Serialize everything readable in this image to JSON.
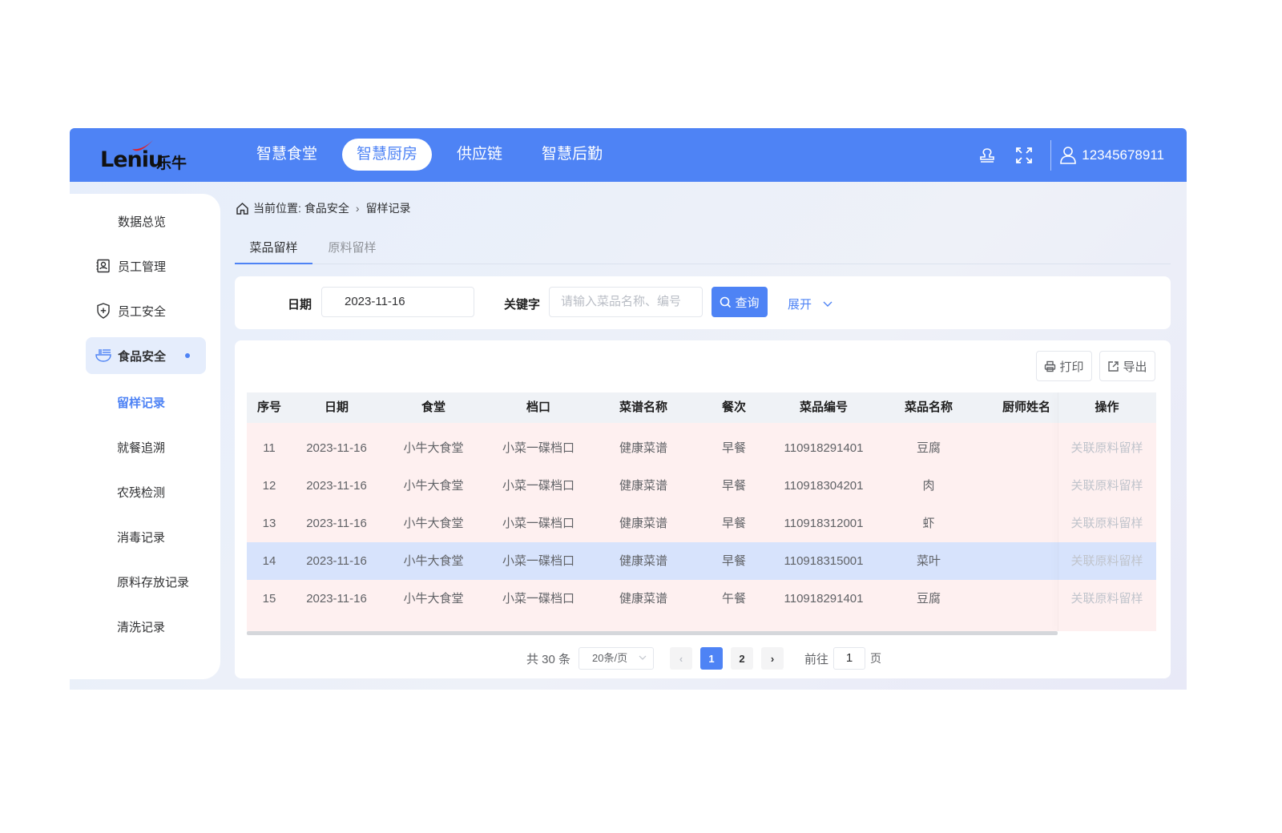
{
  "header": {
    "logo_word": "Leniu",
    "logo_cn": "乐牛",
    "nav": [
      {
        "label": "智慧食堂",
        "active": false
      },
      {
        "label": "智慧厨房",
        "active": true
      },
      {
        "label": "供应链",
        "active": false
      },
      {
        "label": "智慧后勤",
        "active": false
      }
    ],
    "icons": [
      "stamp-icon",
      "fullscreen-icon"
    ],
    "username": "12345678911",
    "brand_color": "#4e83f5"
  },
  "sidebar": {
    "items": [
      {
        "label": "数据总览",
        "icon": ""
      },
      {
        "label": "员工管理",
        "icon": "badge-icon"
      },
      {
        "label": "员工安全",
        "icon": "shield-plus-icon"
      },
      {
        "label": "食品安全",
        "icon": "bowl-icon",
        "active": true
      }
    ],
    "sub_items": [
      {
        "label": "留样记录",
        "active": true
      },
      {
        "label": "就餐追溯"
      },
      {
        "label": "农残检测"
      },
      {
        "label": "消毒记录"
      },
      {
        "label": "原料存放记录"
      },
      {
        "label": "清洗记录"
      }
    ]
  },
  "breadcrumb": {
    "prefix": "当前位置:",
    "level1": "食品安全",
    "level2": "留样记录"
  },
  "tabs": [
    {
      "label": "菜品留样",
      "active": true
    },
    {
      "label": "原料留样",
      "active": false
    }
  ],
  "search": {
    "date_label": "日期",
    "date_value": "2023-11-16",
    "keyword_label": "关键字",
    "keyword_placeholder": "请输入菜品名称、编号",
    "query_label": "查询",
    "expand_label": "展开"
  },
  "toolbar": {
    "print_label": "打印",
    "export_label": "导出"
  },
  "table": {
    "columns": [
      "序号",
      "日期",
      "食堂",
      "档口",
      "菜谱名称",
      "餐次",
      "菜品编号",
      "菜品名称",
      "厨师姓名",
      "操作"
    ],
    "rows": [
      {
        "no": "11",
        "date": "2023-11-16",
        "canteen": "小牛大食堂",
        "stall": "小菜一碟档口",
        "menu": "健康菜谱",
        "meal": "早餐",
        "code": "110918291401",
        "dish": "豆腐",
        "chef": "",
        "action": "关联原料留样"
      },
      {
        "no": "12",
        "date": "2023-11-16",
        "canteen": "小牛大食堂",
        "stall": "小菜一碟档口",
        "menu": "健康菜谱",
        "meal": "早餐",
        "code": "110918304201",
        "dish": "肉",
        "chef": "",
        "action": "关联原料留样"
      },
      {
        "no": "13",
        "date": "2023-11-16",
        "canteen": "小牛大食堂",
        "stall": "小菜一碟档口",
        "menu": "健康菜谱",
        "meal": "早餐",
        "code": "110918312001",
        "dish": "虾",
        "chef": "",
        "action": "关联原料留样"
      },
      {
        "no": "14",
        "date": "2023-11-16",
        "canteen": "小牛大食堂",
        "stall": "小菜一碟档口",
        "menu": "健康菜谱",
        "meal": "早餐",
        "code": "110918315001",
        "dish": "菜叶",
        "chef": "",
        "action": "关联原料留样",
        "highlighted": true
      },
      {
        "no": "15",
        "date": "2023-11-16",
        "canteen": "小牛大食堂",
        "stall": "小菜一碟档口",
        "menu": "健康菜谱",
        "meal": "午餐",
        "code": "110918291401",
        "dish": "豆腐",
        "chef": "",
        "action": "关联原料留样"
      }
    ]
  },
  "pagination": {
    "total_text": "共 30 条",
    "page_size": "20条/页",
    "pages": [
      "1",
      "2"
    ],
    "current_page": "1",
    "goto_label": "前往",
    "goto_value": "1",
    "page_suffix": "页"
  }
}
